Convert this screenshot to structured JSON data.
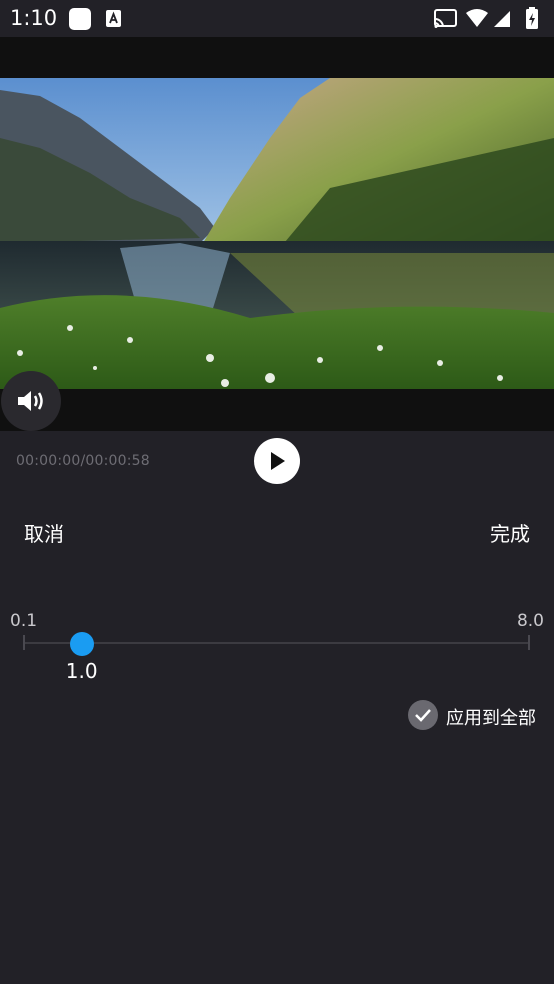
{
  "status_bar": {
    "time": "1:10",
    "icons": [
      "square-notification-icon",
      "a-notification-icon",
      "cast-icon",
      "wifi-icon",
      "signal-icon",
      "battery-charging-icon"
    ]
  },
  "player": {
    "timecode": "00:00:00/00:00:58",
    "volume_icon": "volume-icon",
    "play_icon": "play-icon"
  },
  "actions": {
    "cancel_label": "取消",
    "done_label": "完成"
  },
  "speed_slider": {
    "min_label": "0.1",
    "max_label": "8.0",
    "current_label": "1.0",
    "min": 0.1,
    "max": 8.0,
    "value": 1.0,
    "accent_color": "#1a9cf2"
  },
  "apply_all": {
    "label": "应用到全部",
    "checked": true
  }
}
